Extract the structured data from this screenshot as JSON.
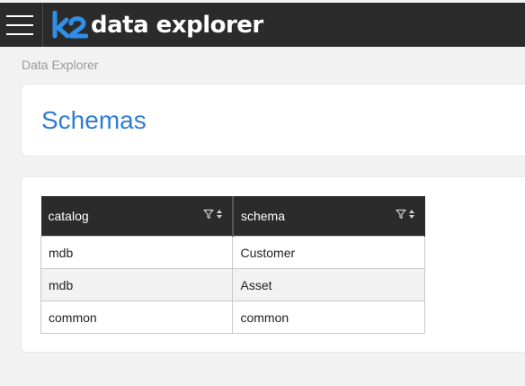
{
  "app": {
    "brand_mark": "k2",
    "brand_name": "data explorer"
  },
  "breadcrumb": "Data Explorer",
  "page": {
    "title": "Schemas"
  },
  "table": {
    "columns": [
      {
        "label": "catalog"
      },
      {
        "label": "schema"
      }
    ],
    "rows": [
      [
        "mdb",
        "Customer"
      ],
      [
        "mdb",
        "Asset"
      ],
      [
        "common",
        "common"
      ]
    ]
  },
  "colors": {
    "topbar": "#2b2b2b",
    "title_blue": "#2f7dd1",
    "logo_blue": "#2f8fe8"
  }
}
